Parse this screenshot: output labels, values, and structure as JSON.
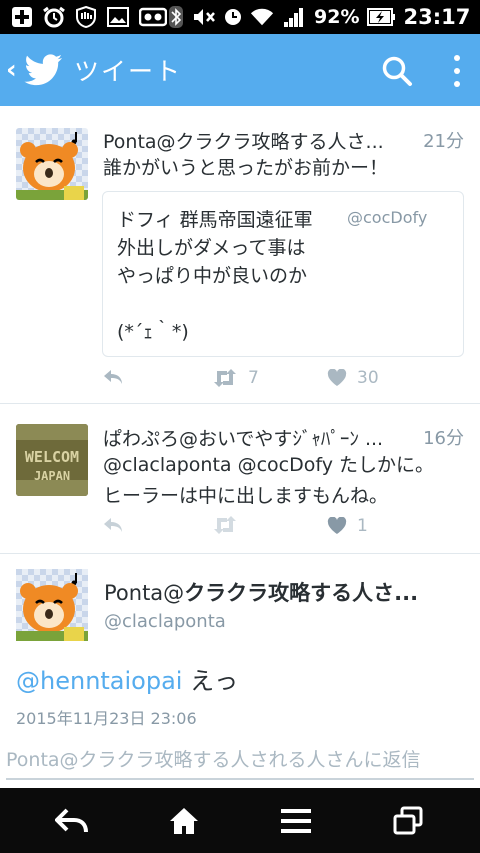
{
  "status_bar": {
    "battery": "92%",
    "time": "23:17"
  },
  "app_bar": {
    "title": "ツイート"
  },
  "tweets": [
    {
      "name": "Ponta@クラクラ攻略する人さ...",
      "time": "21分",
      "text": "誰かがいうと思ったがお前かー！",
      "quote": {
        "name": "ドフィ 群馬帝国遠征軍",
        "handle": "@cocDofy",
        "text": "外出しがダメって事は\nやっぱり中が良いのか\n\n(*´ｪ｀*)"
      },
      "retweets": "7",
      "likes": "30"
    },
    {
      "name": "ぱわぷろ@おいでやすｼﾞｬﾊﾟｰﾝ ...",
      "time": "16分",
      "mentions": "@claclaponta @cocDofy",
      "text_line1": "たしかに。",
      "text_line2": "ヒーラーは中に出しますもんね。",
      "likes": "1"
    }
  ],
  "detail": {
    "name_prefix": "Ponta@",
    "name_rest": "クラクラ攻略する人さ...",
    "handle": "@claclaponta",
    "mention": "@henntaiopai",
    "text": " えっ",
    "date": "2015年11月23日 23:06"
  },
  "reply": {
    "placeholder": "Ponta@クラクラ攻略する人される人さんに返信"
  },
  "colors": {
    "twitter_blue": "#55acee",
    "grey_text": "#8899a6"
  }
}
